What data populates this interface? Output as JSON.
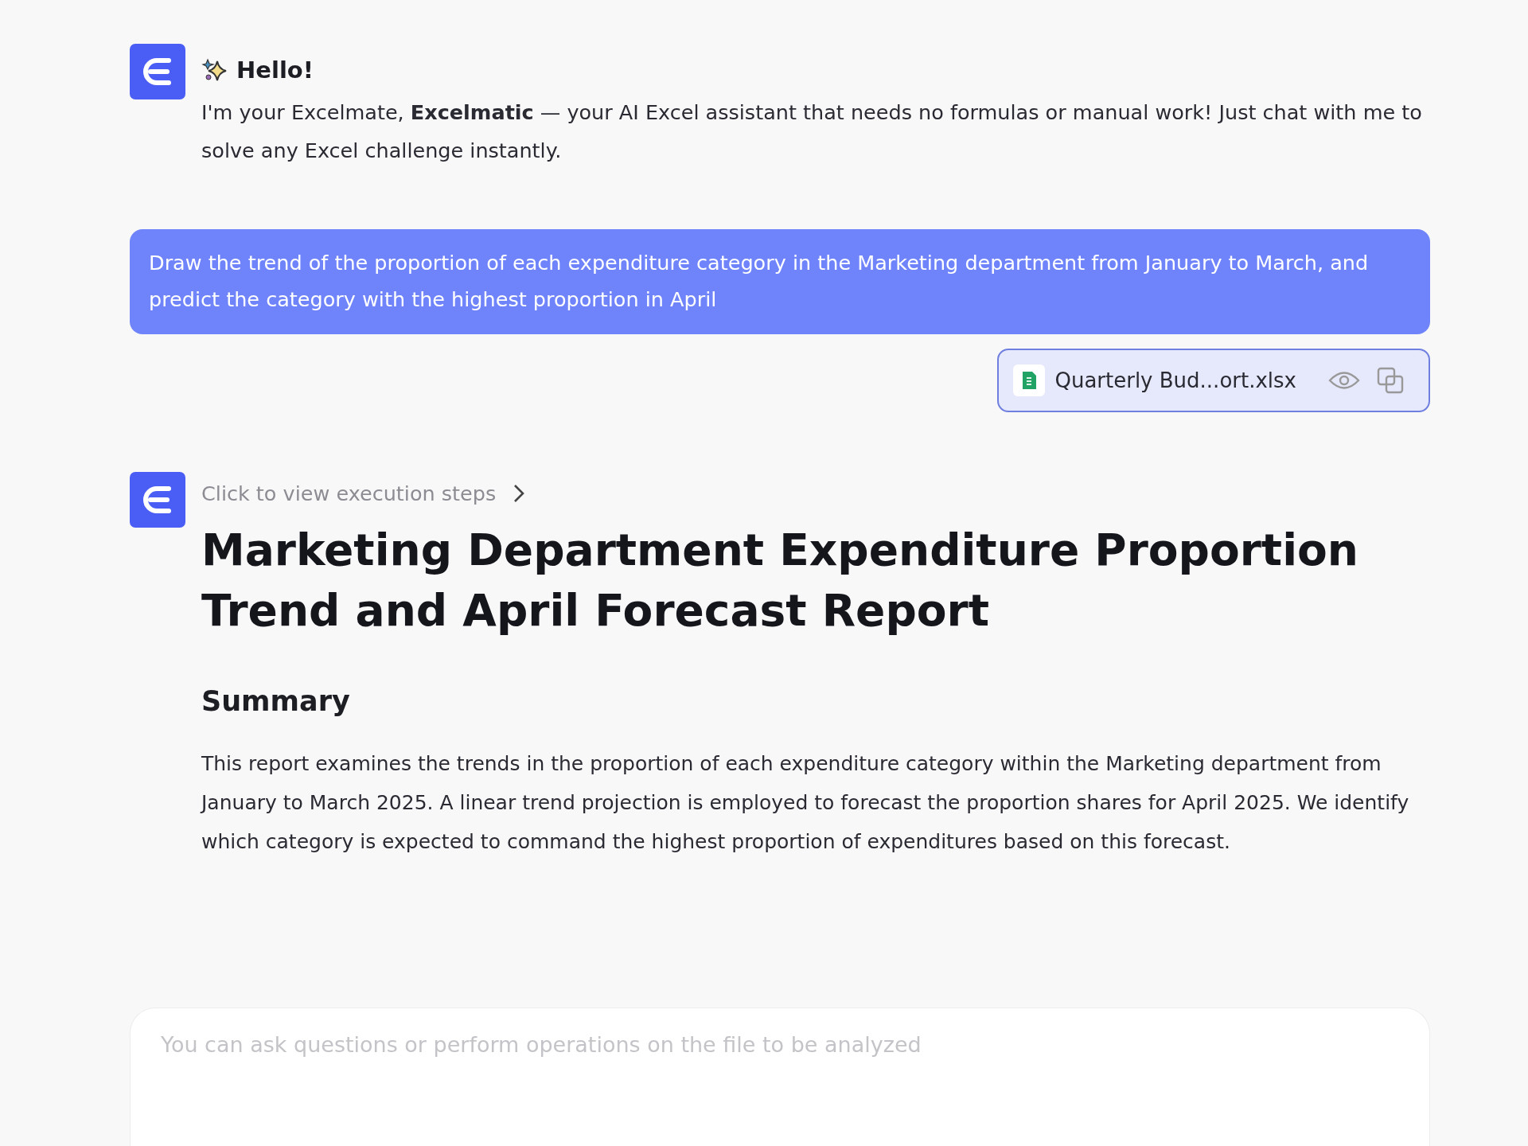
{
  "greeting": {
    "title": "Hello!",
    "message": "I'm your Excelmate, **Excelmatic** — your AI Excel assistant that needs no formulas or manual work! Just chat with me to solve any Excel challenge instantly."
  },
  "user_message": {
    "text": "Draw the trend of the proportion of each expenditure category in the Marketing department from January to March, and predict the category with the highest proportion in April"
  },
  "attachment": {
    "file_name": "Quarterly Bud...ort.xlsx"
  },
  "response": {
    "steps_link": "Click to view execution steps",
    "title": "Marketing Department Expenditure Proportion Trend and April Forecast Report",
    "sections": [
      {
        "heading": "Summary",
        "body": "This report examines the trends in the proportion of each expenditure category within the Marketing department from January to March 2025. A linear trend projection is employed to forecast the proportion shares for April 2025. We identify which category is expected to command the highest proportion of expenditures based on this forecast."
      }
    ]
  },
  "input": {
    "placeholder": "You can ask questions or perform operations on the file to be analyzed"
  }
}
